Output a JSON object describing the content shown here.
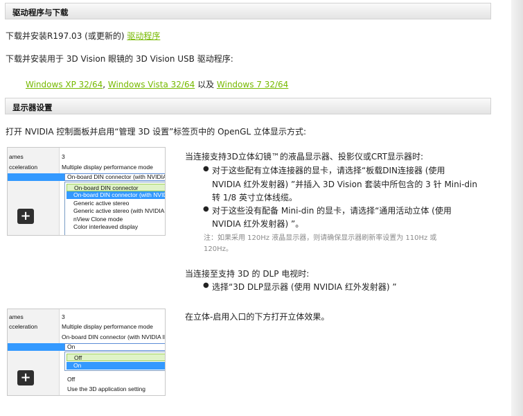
{
  "section1": {
    "title": "驱动程序与下载",
    "line1_prefix": "下载并安装R197.03 (或更新的) ",
    "line1_link": "驱动程序",
    "line2": "下载并安装用于 3D Vision 眼镜的 3D Vision USB 驱动程序:",
    "links": {
      "xp": "Windows XP 32/64",
      "sep1": ", ",
      "vista": "Windows Vista 32/64",
      "sep2": " 以及 ",
      "win7": "Windows 7 32/64"
    }
  },
  "section2": {
    "title": "显示器设置",
    "intro": "打开 NVIDIA 控制面板并启用“管理 3D 设置”标签页中的 OpenGL 立体显示方式:",
    "lcd": {
      "heading": "当连接支持3D立体幻镜™的液晶显示器、投影仪或CRT显示器时:",
      "bullet1_l1": "对于这些配有立体连接器的显卡，请选择“板载DIN连接器 (使用",
      "bullet1_l2": "NVIDIA 红外发射器) ”并插入 3D Vision 套装中所包含的 3 针 Mini-din",
      "bullet1_l3": "转 1/8 英寸立体线缆。",
      "bullet2_l1": "对于这些没有配备 Mini-din 的显卡，请选择“通用活动立体 (使用",
      "bullet2_l2": "NVIDIA 红外发射器) ”。",
      "note_l1": "注：如果采用 120Hz 液晶显示器，则请确保显示器刷新率设置为 110Hz 或",
      "note_l2": "120Hz。"
    },
    "dlp": {
      "heading": "当连接至支持 3D 的 DLP 电视时:",
      "bullet": "选择“3D DLP显示器 (使用 NVIDIA 红外发射器) ”"
    },
    "enable_text": "在立体-启用入口的下方打开立体效果。"
  },
  "thumb1": {
    "row1_left": "ames",
    "row1_right": "3",
    "row2_left": "cceleration",
    "row2_right": "Multiple display performance mode",
    "field": "On-board DIN connector (with NVIDIA IR",
    "items": [
      "On-board DIN connector",
      "On-board DIN connector (with NVIDIA IR",
      "Generic active stereo",
      "Generic active stereo (with NVIDIA IR",
      "nView Clone mode",
      "Color interleaved display"
    ],
    "plus": "+"
  },
  "thumb2": {
    "row1_left": "ames",
    "row1_right": "3",
    "row2_left": "cceleration",
    "row2_right": "Multiple display performance mode",
    "row3_right": "On-board DIN connector (with NVIDIA IR",
    "field": "On",
    "items": [
      "Off",
      "On"
    ],
    "below1": "Off",
    "below2": "Use the 3D application setting",
    "plus": "+"
  }
}
